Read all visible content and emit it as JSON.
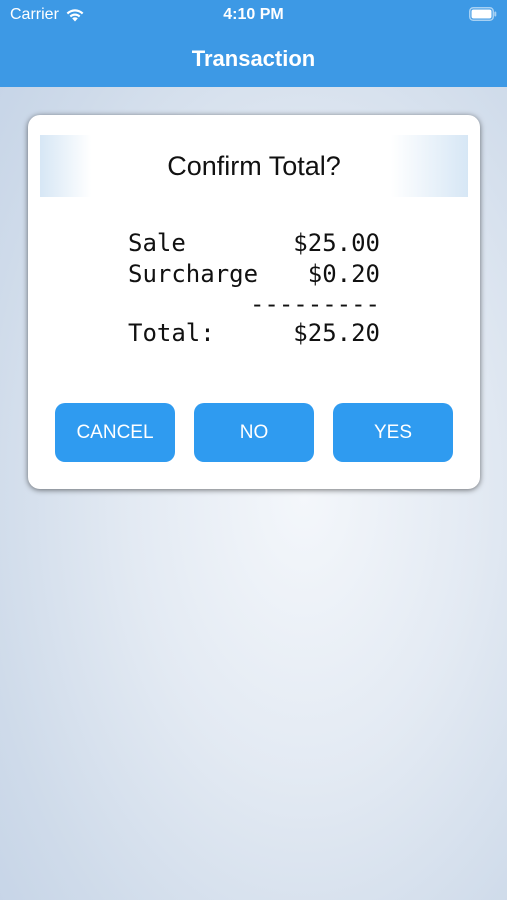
{
  "status_bar": {
    "carrier": "Carrier",
    "time": "4:10 PM"
  },
  "nav": {
    "title": "Transaction"
  },
  "dialog": {
    "title": "Confirm Total?",
    "receipt": {
      "sale_label": "Sale",
      "sale_value": "$25.00",
      "surcharge_label": "Surcharge",
      "surcharge_value": "$0.20",
      "divider": "---------",
      "total_label": "Total:",
      "total_value": "$25.20"
    },
    "buttons": {
      "cancel": "CANCEL",
      "no": "NO",
      "yes": "YES"
    }
  },
  "colors": {
    "header": "#3d99e5",
    "button": "#2f9bf0"
  },
  "icons": [
    "wifi-icon",
    "battery-icon"
  ]
}
